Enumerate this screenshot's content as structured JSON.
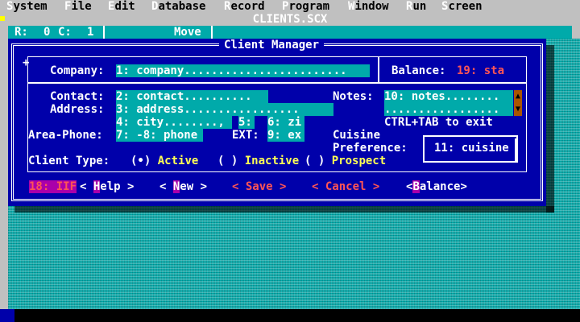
{
  "menubar": {
    "items": [
      {
        "hot": "S",
        "rest": "ystem"
      },
      {
        "hot": "F",
        "rest": "ile"
      },
      {
        "hot": "E",
        "rest": "dit"
      },
      {
        "hot": "D",
        "rest": "atabase"
      },
      {
        "hot": "R",
        "rest": "ecord"
      },
      {
        "hot": "P",
        "rest": "rogram"
      },
      {
        "hot": "W",
        "rest": "indow"
      },
      {
        "hot": "R",
        "rest": "un"
      },
      {
        "hot": "S",
        "rest": "creen"
      }
    ]
  },
  "window": {
    "title": "CLIENTS.SCX"
  },
  "statusbar": {
    "row_label": "R:",
    "row_value": "0",
    "col_label": "C:",
    "col_value": "1",
    "mode": "Move"
  },
  "dialog": {
    "title": "Client Manager",
    "company": {
      "label": "Company:",
      "value": "1: company........................"
    },
    "balance": {
      "label": "Balance:",
      "value": "19: sta"
    },
    "contact": {
      "label": "Contact:",
      "value": "2: contact.........."
    },
    "address": {
      "label": "Address:",
      "value": "3: address................."
    },
    "city": {
      "value": "4: city........,"
    },
    "state": {
      "value": "5:"
    },
    "zip": {
      "value": "6: zi"
    },
    "area_phone": {
      "label": "Area-Phone:",
      "value": "7: -8: phone"
    },
    "ext": {
      "label": "EXT:",
      "value": "9: ex"
    },
    "notes": {
      "label": "Notes:",
      "value_line1": "10: notes........",
      "value_line2": ".................",
      "hint": "CTRL+TAB to exit"
    },
    "cuisine": {
      "label_line1": "Cuisine",
      "label_line2": "Preference:",
      "value": "11: cuisine"
    },
    "client_type": {
      "label": "Client Type:",
      "options": [
        {
          "mark": "(•)",
          "label": "Active"
        },
        {
          "mark": "( )",
          "label": "Inactive"
        },
        {
          "mark": "( )",
          "label": "Prospect"
        }
      ]
    },
    "buttons": {
      "field_id": "18: IIF",
      "help": {
        "left": "< ",
        "hot": "H",
        "rest": "elp >"
      },
      "new": {
        "left": "< ",
        "hot": "N",
        "rest": "ew >"
      },
      "save": "< Save >",
      "cancel": "< Cancel >",
      "balance": {
        "left": "<",
        "hot": "B",
        "rest": "alance>"
      }
    }
  },
  "colors": {
    "dialog_bg": "#0000aa",
    "field_bg": "#00aaaa",
    "desktop_bg": "#00aaaa",
    "menubar_bg": "#c0c0c0",
    "label_text": "#ffffff",
    "field_text": "#ffffff",
    "hotkey_bg": "#aa00aa",
    "disabled_text": "#ff5555"
  }
}
